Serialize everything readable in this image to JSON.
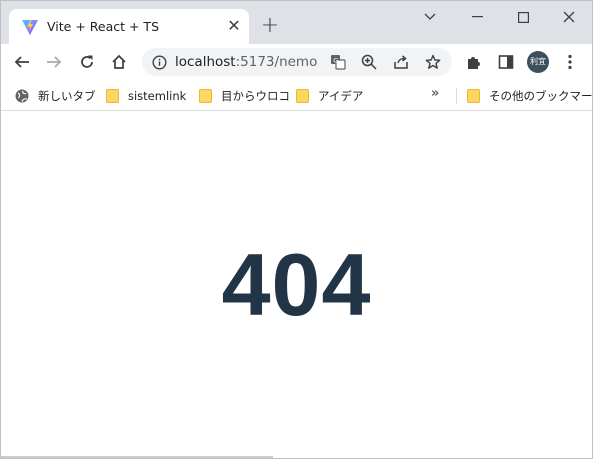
{
  "tab": {
    "title": "Vite + React + TS",
    "close_glyph": "✕",
    "new_tab_glyph": "+"
  },
  "window_controls": [
    "chevron-down-icon",
    "minimize-icon",
    "maximize-icon",
    "close-icon"
  ],
  "toolbar": {
    "url_host": "localhost",
    "url_rest": ":5173/nemo",
    "profile_initials": "利宜"
  },
  "bookmarks": {
    "items": [
      {
        "label": "新しいタブ",
        "icon": "globe-icon"
      },
      {
        "label": "sistemlink",
        "icon": "folder-icon"
      },
      {
        "label": "目からウロコ",
        "icon": "folder-icon"
      },
      {
        "label": "アイデア",
        "icon": "folder-icon"
      }
    ],
    "more_glyph": "»",
    "other_label": "その他のブックマーク"
  },
  "page": {
    "heading": "404",
    "heading_color": "#213547"
  },
  "colors": {
    "titlebar": "#dee1e6",
    "omnibox": "#f1f3f4",
    "folder": "#fdd663"
  }
}
